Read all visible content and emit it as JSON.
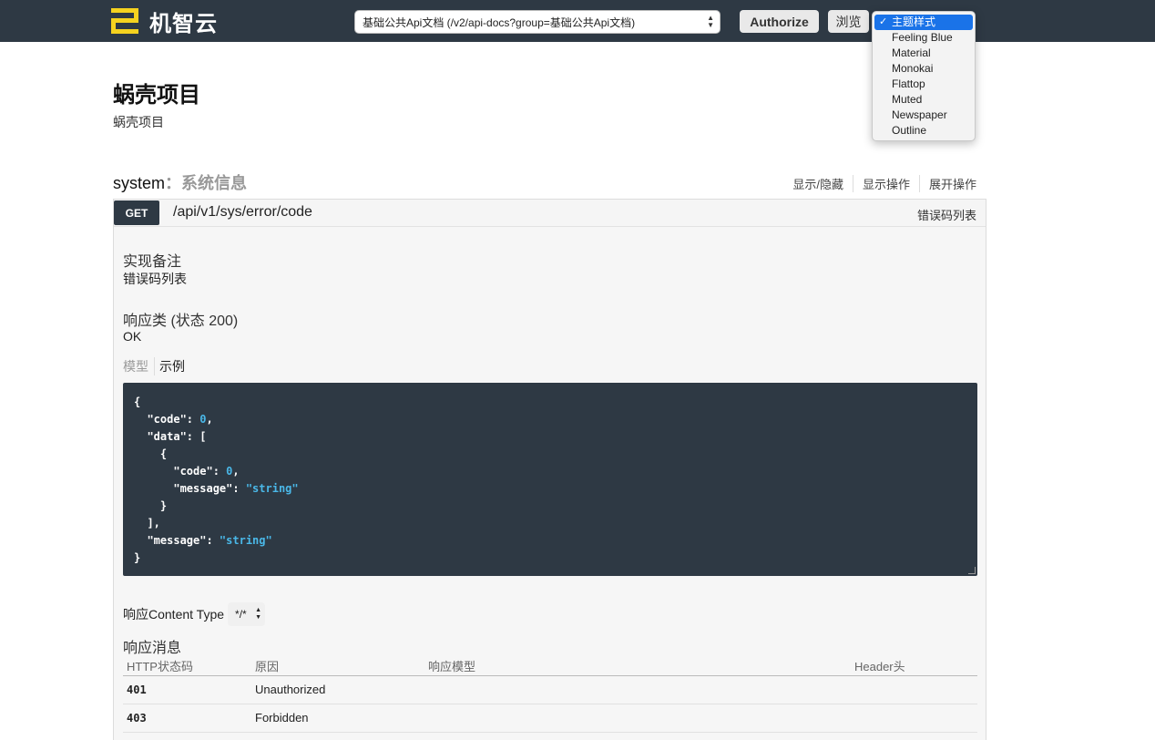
{
  "header": {
    "logo_text": "机智云",
    "api_select_value": "基础公共Api文档 (/v2/api-docs?group=基础公共Api文档)",
    "authorize_label": "Authorize",
    "browse_label": "浏览",
    "theme_menu": {
      "selected": "主题样式",
      "options": [
        "Feeling Blue",
        "Material",
        "Monokai",
        "Flattop",
        "Muted",
        "Newspaper",
        "Outline"
      ]
    }
  },
  "project": {
    "title": "蜗壳项目",
    "description": "蜗壳项目"
  },
  "section": {
    "name": "system",
    "separator": "：",
    "description": "系统信息",
    "ops": [
      "显示/隐藏",
      "显示操作",
      "展开操作"
    ]
  },
  "endpoint": {
    "method": "GET",
    "path": "/api/v1/sys/error/code",
    "summary": "错误码列表",
    "notes_heading": "实现备注",
    "notes_text": "错误码列表",
    "response_class_heading": "响应类 (状态 200)",
    "response_class_text": "OK",
    "tab_model": "模型",
    "tab_example": "示例",
    "content_type_label": "响应Content Type",
    "content_type_value": "*/*",
    "messages_heading": "响应消息",
    "messages_columns": [
      "HTTP状态码",
      "原因",
      "响应模型",
      "Header头"
    ],
    "messages_rows": [
      {
        "code": "401",
        "reason": "Unauthorized"
      },
      {
        "code": "403",
        "reason": "Forbidden"
      }
    ]
  },
  "colors": {
    "topbar": "#2e3944",
    "logo_accent": "#f5d21f",
    "code_string": "#4ab8e8",
    "menu_selected": "#1a73e8"
  }
}
